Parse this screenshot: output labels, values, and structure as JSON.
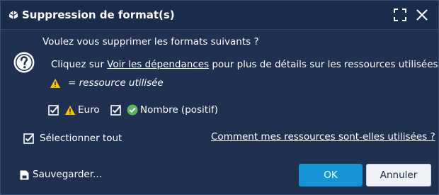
{
  "window": {
    "title": "Suppression de format(s)",
    "icons": {
      "app": "app-logo-icon",
      "maximize": "maximize-icon",
      "close": "close-icon"
    }
  },
  "body": {
    "question": "Voulez vous supprimer les formats suivants ?",
    "detail_prefix": "Cliquez sur ",
    "detail_link": "Voir les dépendances",
    "detail_suffix": " pour plus de détails sur les ressources utilisées.",
    "legend_text": "= ressource utilisée"
  },
  "formats": [
    {
      "label": "Euro",
      "checked": true,
      "status_icon": "warning-icon"
    },
    {
      "label": "Nombre (positif)",
      "checked": true,
      "status_icon": "check-circle-icon"
    }
  ],
  "select_all": {
    "label": "Sélectionner tout",
    "checked": true
  },
  "help_link": "Comment mes ressources sont-elles utilisées ?",
  "footer": {
    "save_label": "Sauvegarder...",
    "ok_label": "OK",
    "cancel_label": "Annuler"
  },
  "colors": {
    "background": "#1f3050",
    "titlebar": "#1b2b4c",
    "accent": "#1594d8",
    "warning": "#f5c400",
    "success": "#5bb75b"
  }
}
